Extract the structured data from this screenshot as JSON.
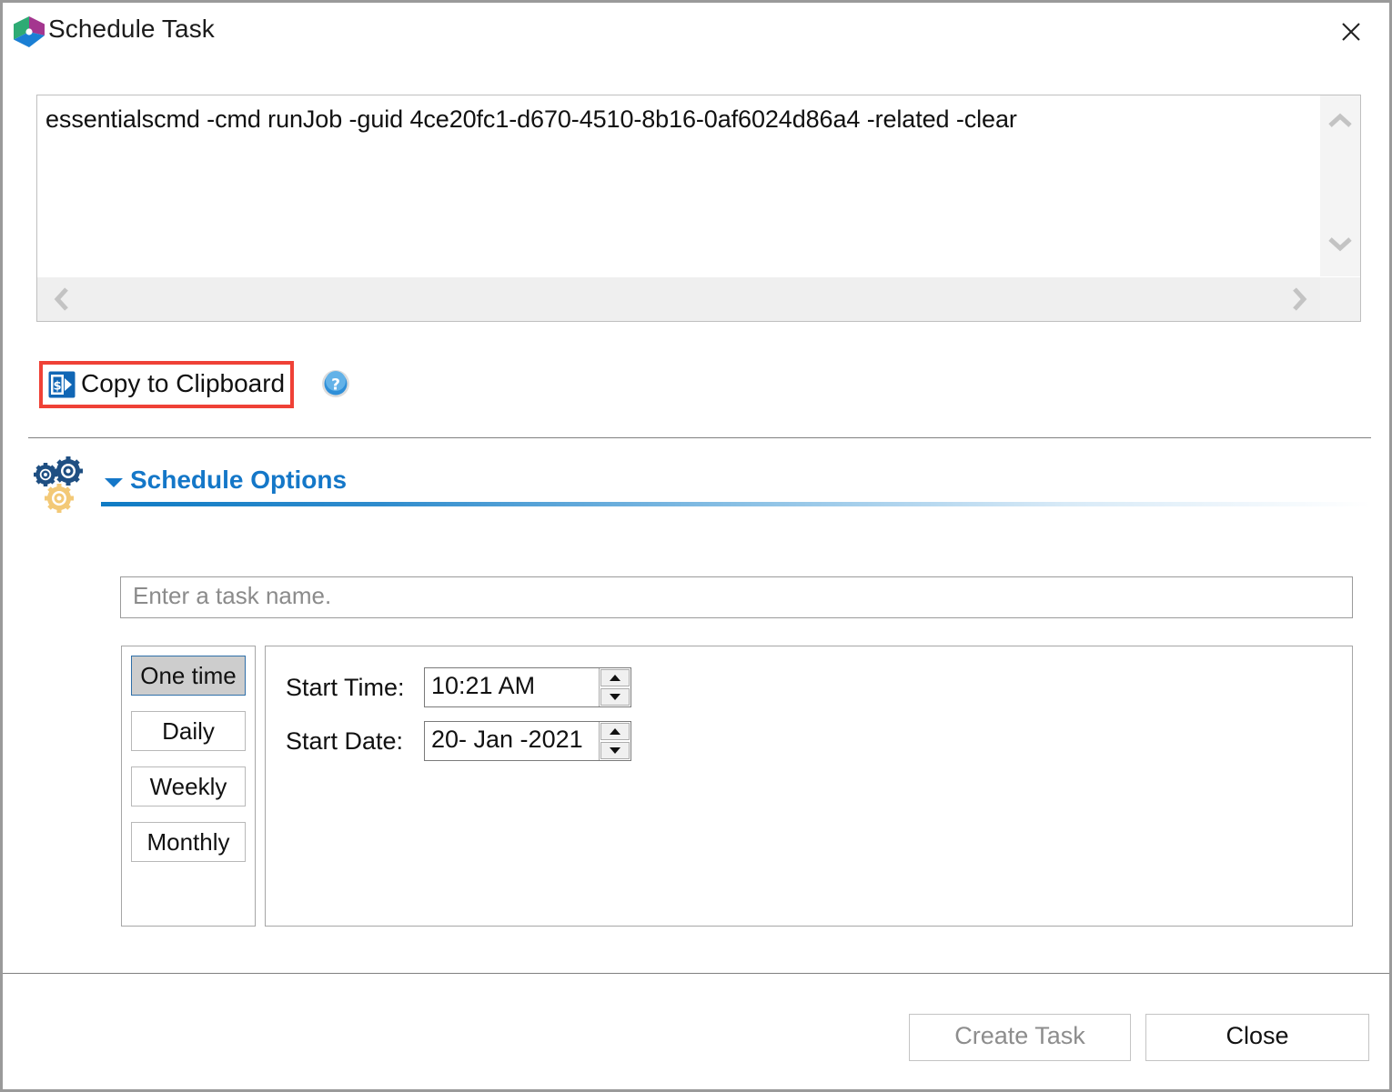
{
  "window": {
    "title": "Schedule Task",
    "app_icon": "cube-logo-icon",
    "close_icon": "close-icon"
  },
  "command_box": {
    "command_text": "essentialscmd -cmd runJob -guid 4ce20fc1-d670-4510-8b16-0af6024d86a4 -related -clear",
    "scroll_up_icon": "chevron-up-icon",
    "scroll_down_icon": "chevron-down-icon",
    "scroll_left_icon": "chevron-left-icon",
    "scroll_right_icon": "chevron-right-icon"
  },
  "copy_row": {
    "copy_label": "Copy to Clipboard",
    "copy_icon": "clipboard-copy-icon",
    "help_icon": "help-question-icon",
    "highlight_color": "#ef4136"
  },
  "schedule_options": {
    "section_title": "Schedule Options",
    "gears_icon": "gears-icon",
    "caret_icon": "caret-down-icon",
    "accent_color": "#1477c8",
    "expanded": true,
    "task_name": {
      "value": "",
      "placeholder": "Enter a task name."
    },
    "frequencies": [
      {
        "label": "One time",
        "selected": true
      },
      {
        "label": "Daily",
        "selected": false
      },
      {
        "label": "Weekly",
        "selected": false
      },
      {
        "label": "Monthly",
        "selected": false
      }
    ],
    "fields": {
      "start_time_label": "Start Time:",
      "start_time_value": "10:21 AM",
      "start_date_label": "Start Date:",
      "start_date_value": "20- Jan -2021"
    }
  },
  "footer": {
    "create_label": "Create Task",
    "create_enabled": false,
    "close_label": "Close"
  }
}
